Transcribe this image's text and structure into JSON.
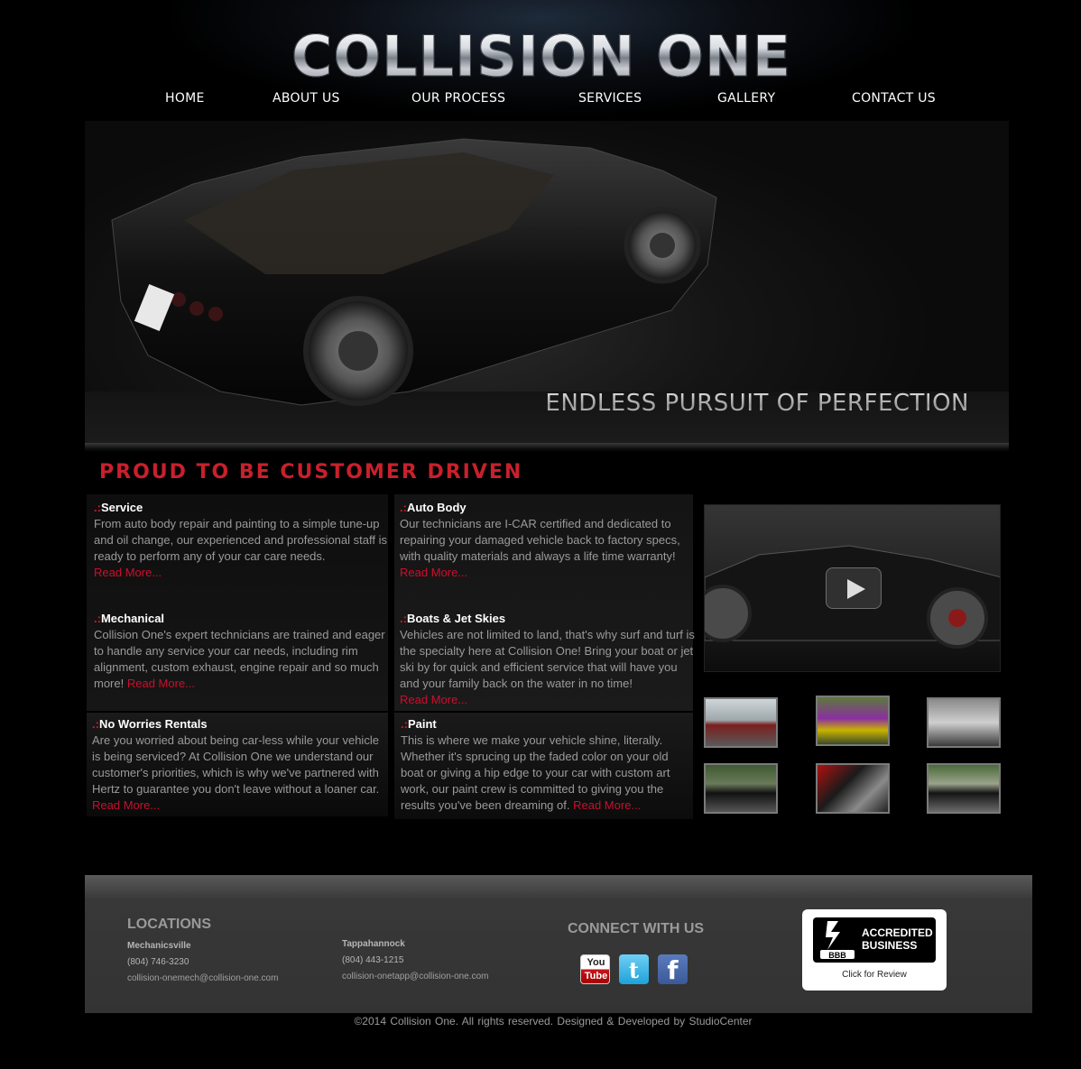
{
  "brand": {
    "logo_text": "COLLISION ONE"
  },
  "nav": [
    {
      "label": "HOME"
    },
    {
      "label": "ABOUT US"
    },
    {
      "label": "OUR PROCESS"
    },
    {
      "label": "SERVICES"
    },
    {
      "label": "GALLERY"
    },
    {
      "label": "CONTACT US"
    }
  ],
  "hero": {
    "tagline": "ENDLESS PURSUIT OF PERFECTION"
  },
  "section": {
    "heading": "PROUD TO BE CUSTOMER DRIVEN"
  },
  "services": [
    {
      "prefix": ".:",
      "title": "Service",
      "text": "From auto body repair and painting to a simple tune-up and oil change, our experienced and professional staff is ready to perform any of your car care needs.",
      "more": "Read More..."
    },
    {
      "prefix": ".:",
      "title": "Auto Body",
      "text": "Our technicians are I-CAR certified and dedicated to repairing your damaged vehicle back to factory specs, with quality materials and always a life time warranty!",
      "more": "Read More..."
    },
    {
      "prefix": ".:",
      "title": "Mechanical",
      "text": "Collision One's expert technicians are trained and eager to handle any service your car needs, including rim alignment, custom exhaust, engine repair and so much more!",
      "more": "Read More..."
    },
    {
      "prefix": ".:",
      "title": "Boats & Jet Skies",
      "text": "Vehicles are not limited to land, that's why surf and turf is the specialty here at Collision One! Bring your boat or jet ski by for quick and efficient service that will have you and your family back on the water in no time!",
      "more": "Read More..."
    },
    {
      "prefix": ".:",
      "title": "No Worries Rentals",
      "text": "Are you worried about being car-less while your vehicle is being serviced? At Collision One we understand our customer's priorities, which is why we've partnered with Hertz to guarantee you don't leave without a loaner car.",
      "more": "Read More..."
    },
    {
      "prefix": ".:",
      "title": "Paint",
      "text": "This is where we make your vehicle shine, literally. Whether it's sprucing up the faded color on your old boat or giving a hip edge to your car with custom art work, our paint crew is committed to giving you the results you've been dreaming of.",
      "more": "Read More..."
    }
  ],
  "footer": {
    "locations_title": "LOCATIONS",
    "locations": [
      {
        "name": "Mechanicsville",
        "phone": "(804) 746-3230",
        "email": "collision-onemech@collision-one.com"
      },
      {
        "name": "Tappahannock",
        "phone": "(804) 443-1215",
        "email": "collision-onetapp@collision-one.com"
      }
    ],
    "connect_title": "CONNECT WITH US",
    "social": [
      {
        "name": "youtube-icon",
        "label": "You Tube"
      },
      {
        "name": "twitter-icon",
        "label": ""
      },
      {
        "name": "facebook-icon",
        "label": "f"
      }
    ],
    "bbb": {
      "logo": "BBB",
      "line1": "ACCREDITED",
      "line2": "BUSINESS",
      "cta": "Click for Review"
    }
  },
  "copyright": "©2014 Collision One.    All rights reserved.    Designed & Developed by  StudioCenter",
  "colors": {
    "accent_red": "#c8102e",
    "title_red": "#d01b25",
    "background": "#000000",
    "footer": "#333333"
  }
}
